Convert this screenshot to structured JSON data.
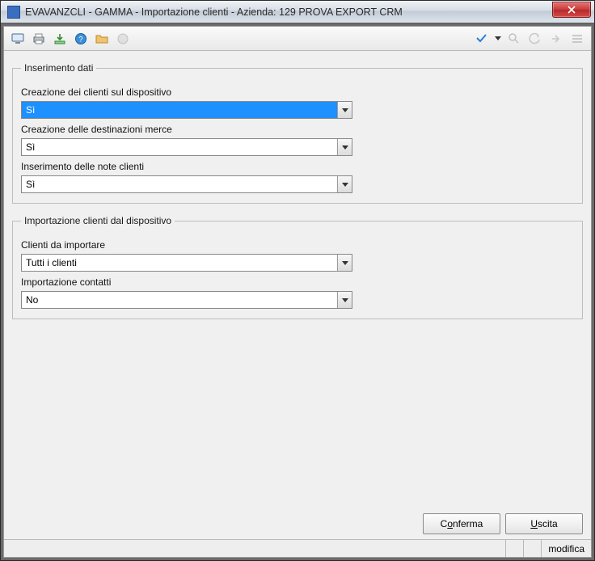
{
  "window": {
    "title": "EVAVANZCLI - GAMMA - Importazione clienti - Azienda:  129 PROVA EXPORT CRM"
  },
  "groups": {
    "ins": {
      "legend": "Inserimento dati",
      "f1": {
        "label": "Creazione dei clienti sul dispositivo",
        "value": "Sì"
      },
      "f2": {
        "label": "Creazione delle destinazioni merce",
        "value": "Sì"
      },
      "f3": {
        "label": "Inserimento delle note clienti",
        "value": "Sì"
      }
    },
    "imp": {
      "legend": "Importazione clienti dal dispositivo",
      "f1": {
        "label": "Clienti da importare",
        "value": "Tutti i clienti"
      },
      "f2": {
        "label": "Importazione contatti",
        "value": "No"
      }
    }
  },
  "buttons": {
    "confirm_pre": "C",
    "confirm_ul": "o",
    "confirm_post": "nferma",
    "exit_pre": "",
    "exit_ul": "U",
    "exit_post": "scita"
  },
  "status": {
    "mode": "modifica"
  }
}
